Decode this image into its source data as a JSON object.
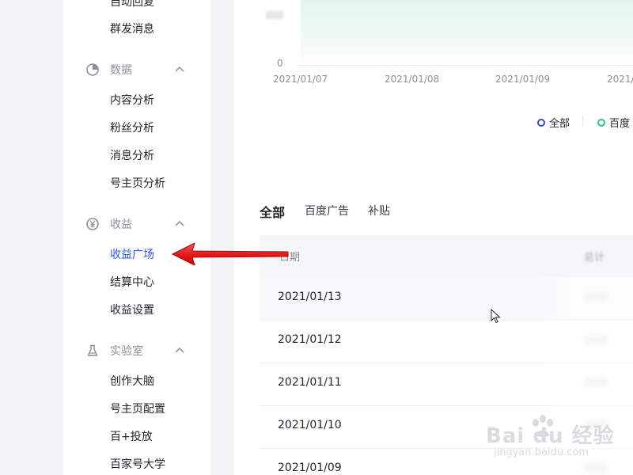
{
  "sidebar": {
    "top_items": [
      {
        "label": "自动回复"
      },
      {
        "label": "群发消息"
      }
    ],
    "groups": [
      {
        "label": "数据",
        "icon": "pie-chart-icon",
        "items": [
          "内容分析",
          "粉丝分析",
          "消息分析",
          "号主页分析"
        ]
      },
      {
        "label": "收益",
        "icon": "yen-circle-icon",
        "items": [
          "收益广场",
          "结算中心",
          "收益设置"
        ],
        "active_item": "收益广场"
      },
      {
        "label": "实验室",
        "icon": "flask-icon",
        "items": [
          "创作大脑",
          "号主页配置",
          "百+投放",
          "百家号大学"
        ]
      }
    ]
  },
  "chart": {
    "y_labels": [
      "0"
    ],
    "x_ticks": [
      "2021/01/07",
      "2021/01/08",
      "2021/01/09",
      "2021/"
    ],
    "legend": [
      {
        "label": "全部",
        "color": "#3b4cca"
      },
      {
        "label": "百度",
        "color": "#2dbd8f"
      }
    ]
  },
  "tabs": {
    "items": [
      "全部",
      "百度广告",
      "补贴"
    ],
    "active": "全部"
  },
  "table": {
    "headers": {
      "date": "日期",
      "total": "总计"
    },
    "rows": [
      {
        "date": "2021/01/13"
      },
      {
        "date": "2021/01/12"
      },
      {
        "date": "2021/01/11"
      },
      {
        "date": "2021/01/10"
      },
      {
        "date": "2021/01/09"
      }
    ]
  },
  "watermark": {
    "brand": "Bai du 经验",
    "url": "jingyan.baidu.com"
  },
  "colors": {
    "accent": "#2f54eb",
    "arrow": "#e31b1b",
    "chart_fill": "#e2f5ec"
  }
}
